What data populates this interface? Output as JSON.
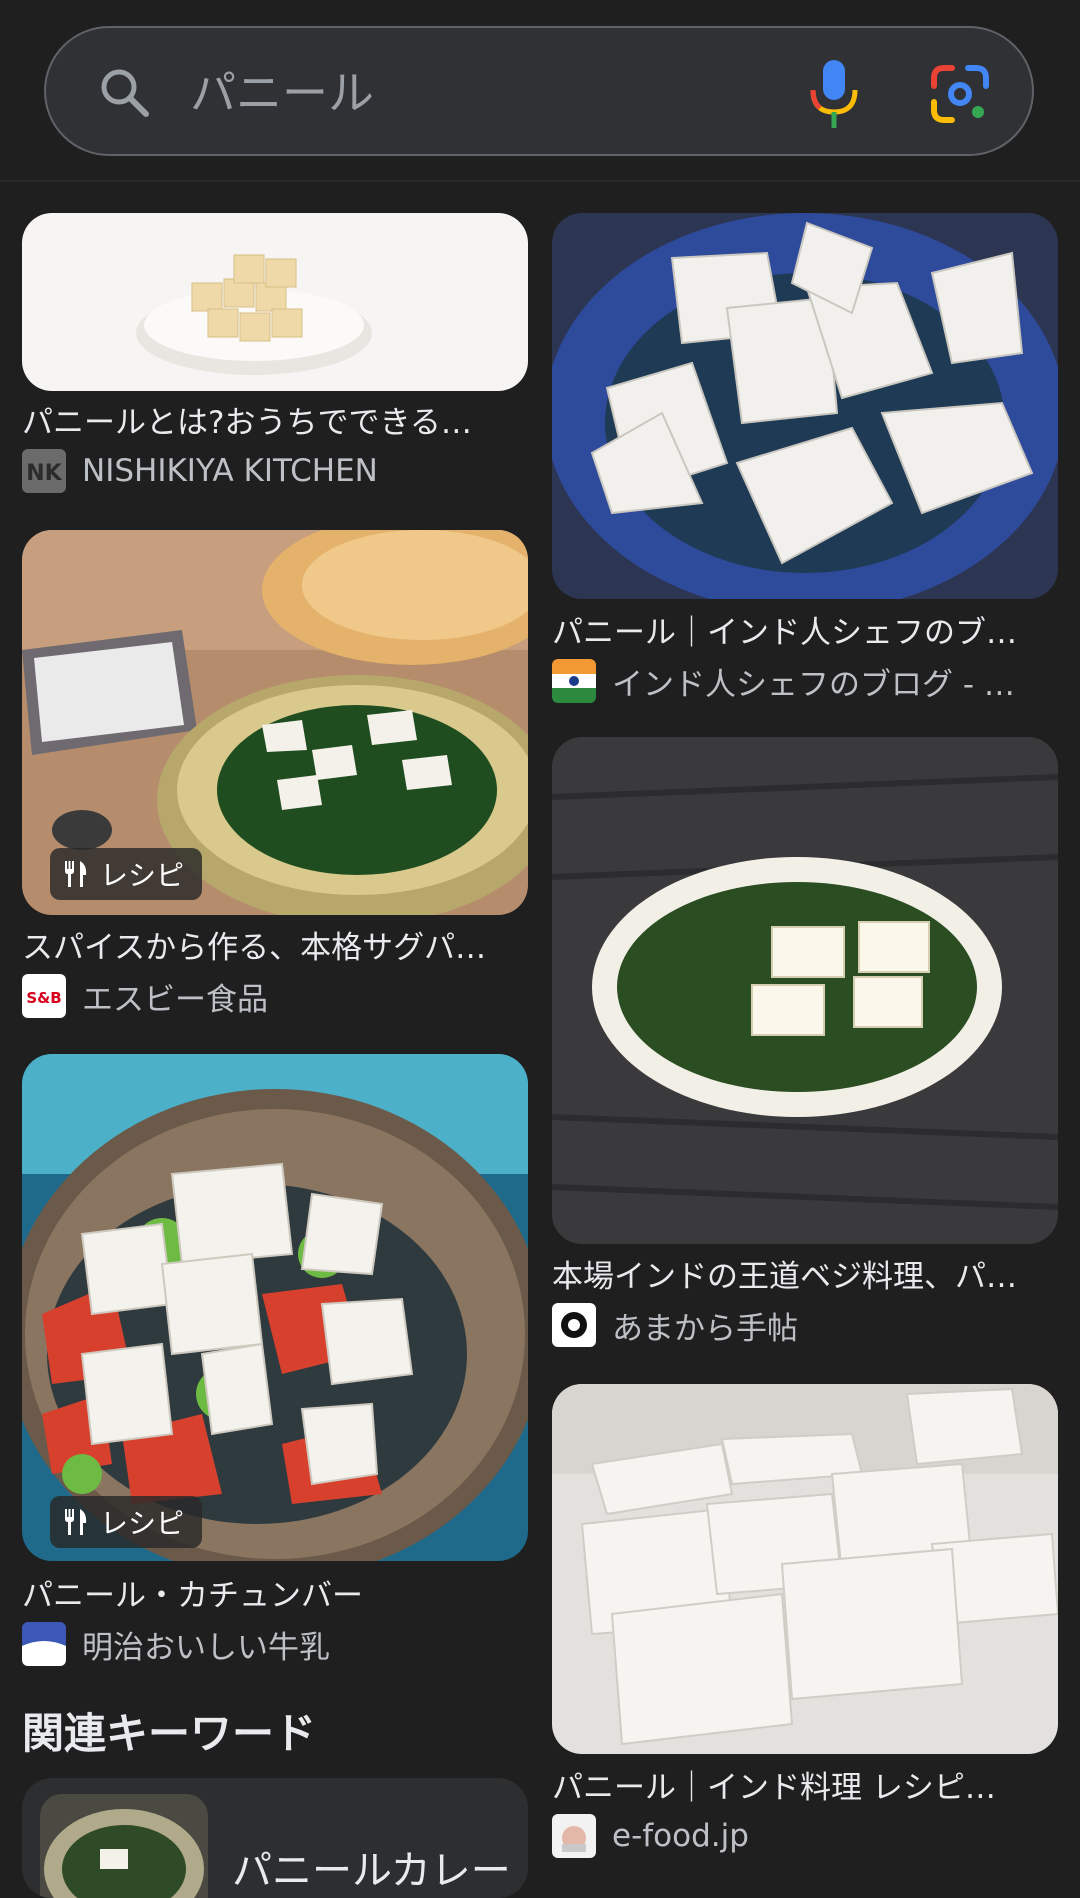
{
  "search": {
    "value": "パニール",
    "placeholder": ""
  },
  "icons": {
    "search": "search-icon",
    "mic": "mic-icon",
    "lens": "lens-icon",
    "recipe": "fork-knife-icon"
  },
  "colors": {
    "background": "#1f1f1f",
    "search_bar": "#303134",
    "google_blue": "#4285f4",
    "google_red": "#ea4335",
    "google_yellow": "#fbbc04",
    "google_green": "#34a853"
  },
  "results": [
    {
      "title": "パニールとは?おうちでできる…",
      "source": "NISHIKIYA KITCHEN",
      "badge": ""
    },
    {
      "title": "パニール｜インド人シェフのブ…",
      "source": "インド人シェフのブログ - …",
      "badge": ""
    },
    {
      "title": "スパイスから作る、本格サグパ…",
      "source": "エスビー食品",
      "badge": "レシピ"
    },
    {
      "title": "本場インドの王道ベジ料理、パ…",
      "source": "あまから手帖",
      "badge": ""
    },
    {
      "title": "パニール・カチュンバー",
      "source": "明治おいしい牛乳",
      "badge": "レシピ"
    },
    {
      "title": "パニール｜インド料理 レシピ…",
      "source": "e-food.jp",
      "badge": ""
    }
  ],
  "favicon_text": {
    "nk": "NK",
    "sb": "S&B"
  },
  "related": {
    "heading": "関連キーワード",
    "items": [
      "パニールカレー"
    ]
  }
}
